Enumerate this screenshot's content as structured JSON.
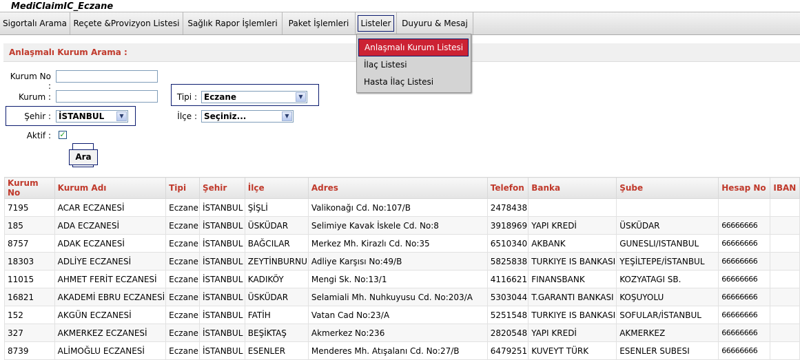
{
  "app": {
    "title": "MediClaimIC_Eczane"
  },
  "menu": [
    {
      "label": "Sigortalı Arama"
    },
    {
      "label": "Reçete &Provizyon Listesi"
    },
    {
      "label": "Sağlık Rapor İşlemleri"
    },
    {
      "label": "Paket İşlemleri"
    },
    {
      "label": "Listeler"
    },
    {
      "label": "Duyuru & Mesaj"
    }
  ],
  "dropdown": {
    "items": [
      {
        "label": "Anlaşmalı Kurum Listesi",
        "selected": true
      },
      {
        "label": "İlaç Listesi"
      },
      {
        "label": "Hasta İlaç Listesi"
      }
    ]
  },
  "search": {
    "title": "Anlaşmalı Kurum Arama :",
    "kurum_no_label": "Kurum No :",
    "kurum_no_value": "",
    "kurum_label": "Kurum :",
    "kurum_value": "",
    "tipi_label": "Tipi :",
    "tipi_value": "Eczane",
    "sehir_label": "Şehir :",
    "sehir_value": "İSTANBUL",
    "ilce_label": "İlçe :",
    "ilce_value": "Seçiniz...",
    "aktif_label": "Aktif :",
    "aktif_checked": true,
    "ara_label": "Ara"
  },
  "table": {
    "columns": [
      "Kurum No",
      "Kurum Adı",
      "Tipi",
      "Şehir",
      "İlçe",
      "Adres",
      "Telefon",
      "Banka",
      "Şube",
      "Hesap No",
      "IBAN"
    ],
    "rows": [
      [
        "7195",
        "ACAR ECZANESİ",
        "Eczane",
        "İSTANBUL",
        "ŞİŞLİ",
        "Valikonağı Cd. No:107/B",
        "2478438",
        "",
        "",
        "",
        ""
      ],
      [
        "185",
        "ADA ECZANESİ",
        "Eczane",
        "İSTANBUL",
        "ÜSKÜDAR",
        "Selimiye Kavak İskele Cd. No:8",
        "3918969",
        "YAPI KREDİ",
        "ÜSKÜDAR",
        "66666666",
        ""
      ],
      [
        "8757",
        "ADAK ECZANESİ",
        "Eczane",
        "İSTANBUL",
        "BAĞCILAR",
        "Merkez Mh. Kirazlı Cd. No:35",
        "6510340",
        "AKBANK",
        "GUNESLI/ISTANBUL",
        "66666666",
        ""
      ],
      [
        "18303",
        "ADLİYE ECZANESİ",
        "Eczane",
        "İSTANBUL",
        "ZEYTİNBURNU",
        "Adliye Karşısı No:49/B",
        "5825838",
        "TURKIYE IS BANKASI",
        "YEŞİLTEPE/İSTANBUL",
        "66666666",
        ""
      ],
      [
        "11015",
        "AHMET FERİT ECZANESİ",
        "Eczane",
        "İSTANBUL",
        "KADIKÖY",
        "Mengi Sk. No:13/1",
        "4116621",
        "FINANSBANK",
        "KOZYATAGI SB.",
        "66666666",
        ""
      ],
      [
        "16821",
        "AKADEMİ EBRU ECZANESİ",
        "Eczane",
        "İSTANBUL",
        "ÜSKÜDAR",
        "Selamiali Mh. Nuhkuyusu Cd. No:203/A",
        "5303044",
        "T.GARANTI BANKASI",
        "KOŞUYOLU",
        "66666666",
        ""
      ],
      [
        "152",
        "AKGÜN ECZANESİ",
        "Eczane",
        "İSTANBUL",
        "FATİH",
        "Vatan Cad No:23/A",
        "5251548",
        "TURKIYE IS BANKASI",
        "SOFULAR/İSTANBUL",
        "66666666",
        ""
      ],
      [
        "327",
        "AKMERKEZ ECZANESİ",
        "Eczane",
        "İSTANBUL",
        "BEŞİKTAŞ",
        "Akmerkez No:236",
        "2820548",
        "YAPI KREDİ",
        "AKMERKEZ",
        "66666666",
        ""
      ],
      [
        "8739",
        "ALİMOĞLU ECZANESİ",
        "Eczane",
        "İSTANBUL",
        "ESENLER",
        "Menderes Mh. Atışalanı Cd. No:27/B",
        "6479251",
        "KUVEYT TÜRK",
        "ESENLER SUBESI",
        "66666666",
        ""
      ]
    ]
  }
}
